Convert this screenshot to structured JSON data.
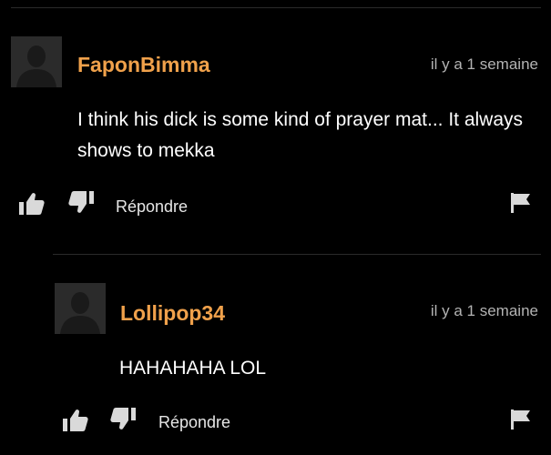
{
  "colors": {
    "background": "#000000",
    "username": "#f0a14b",
    "text": "#ffffff",
    "muted": "#b3b3b3",
    "icon": "#d9d9d9",
    "avatar_bg": "#2b2b2b",
    "avatar_figure": "#1a1a1a"
  },
  "comments": [
    {
      "avatar_icon": "default-user-silhouette",
      "username": "FaponBimma",
      "timestamp": "il y a 1 semaine",
      "text": "I think his dick is some kind of prayer mat... It always shows to mekka",
      "actions": {
        "thumbs_up_icon": "thumbs-up",
        "thumbs_down_icon": "thumbs-down",
        "reply_label": "Répondre",
        "flag_icon": "flag"
      }
    }
  ],
  "replies": [
    {
      "avatar_icon": "default-user-silhouette",
      "username": "Lollipop34",
      "timestamp": "il y a 1 semaine",
      "text": "HAHAHAHA LOL",
      "actions": {
        "thumbs_up_icon": "thumbs-up",
        "thumbs_down_icon": "thumbs-down",
        "reply_label": "Répondre",
        "flag_icon": "flag"
      }
    }
  ]
}
